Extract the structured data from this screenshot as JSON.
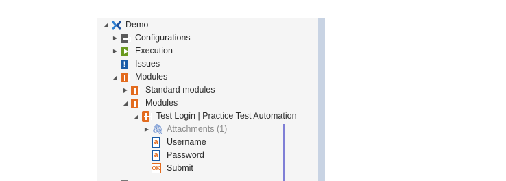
{
  "tree": {
    "demo": {
      "label": "Demo",
      "expander": "◢"
    },
    "configurations": {
      "label": "Configurations",
      "expander": "▶"
    },
    "execution": {
      "label": "Execution",
      "expander": "▶"
    },
    "issues": {
      "label": "Issues",
      "icon_glyph": "!"
    },
    "modules_root": {
      "label": "Modules",
      "expander": "◢"
    },
    "standard_modules": {
      "label": "Standard modules",
      "expander": "▶"
    },
    "modules_child": {
      "label": "Modules",
      "expander": "◢"
    },
    "test_module": {
      "label": "Test Login | Practice Test Automation",
      "expander": "◢"
    },
    "attachments": {
      "label": "Attachments (1)",
      "expander": "▶"
    },
    "username": {
      "label": "Username",
      "icon_glyph": "a"
    },
    "password": {
      "label": "Password",
      "icon_glyph": "a"
    },
    "submit": {
      "label": "Submit",
      "icon_glyph": "OK"
    }
  },
  "icons": {
    "demo": "tosca-workspace-icon",
    "configurations": "configuration-folder-icon",
    "execution": "execution-folder-icon",
    "issues": "issue-icon",
    "modules": "module-folder-icon",
    "test_module": "xmodule-icon",
    "attachments": "paperclip-icon",
    "text_attribute": "textbox-attribute-icon",
    "button_attribute": "button-attribute-icon"
  },
  "colors": {
    "module_orange": "#e36b1e",
    "issue_blue": "#1a5ca8",
    "execution_green": "#6a9a1f",
    "guide_line": "#7f7fd6",
    "scroll_strip": "#c8d3e3"
  }
}
